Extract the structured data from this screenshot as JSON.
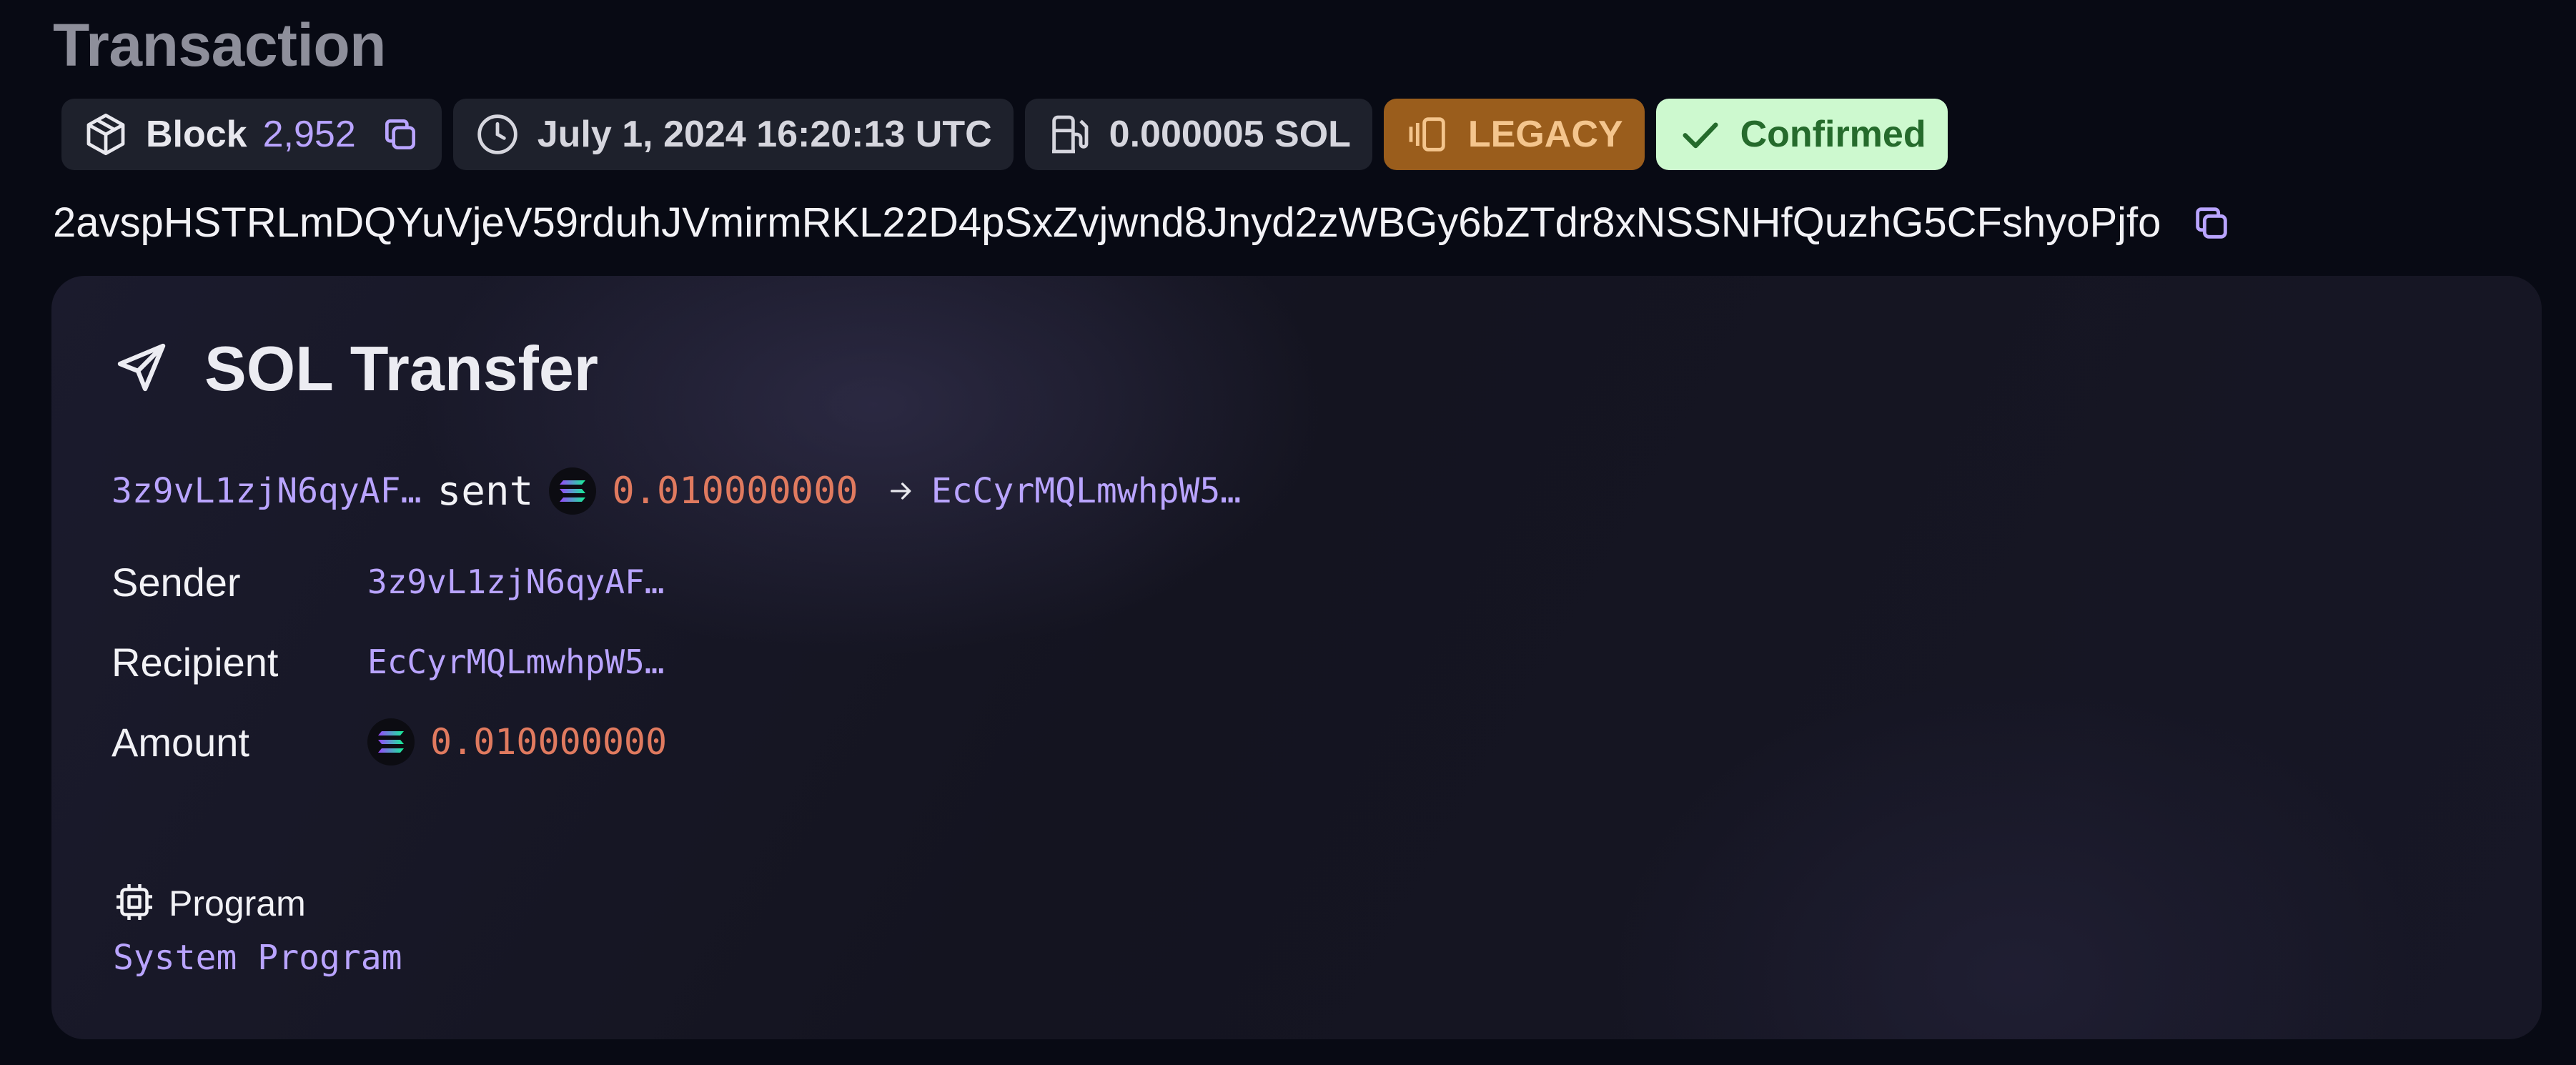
{
  "header": {
    "title": "Transaction"
  },
  "badges": {
    "block_label": "Block",
    "block_number": "2,952",
    "timestamp": "July 1, 2024 16:20:13 UTC",
    "fee": "0.000005 SOL",
    "version": "LEGACY",
    "status": "Confirmed"
  },
  "signature": "2avspHSTRLmDQYuVjeV59rduhJVmirmRKL22D4pSxZvjwnd8Jnyd2zWBGy6bZTdr8xNSSNHfQuzhG5CFshyoPjfo",
  "transfer": {
    "title": "SOL Transfer",
    "summary": {
      "from": "3z9vL1zjN6qyAF…",
      "verb": "sent",
      "amount": "0.010000000",
      "to": "EcCyrMQLmwhpW5…"
    },
    "rows": {
      "sender_label": "Sender",
      "sender_value": "3z9vL1zjN6qyAF…",
      "recipient_label": "Recipient",
      "recipient_value": "EcCyrMQLmwhpW5…",
      "amount_label": "Amount",
      "amount_value": "0.010000000"
    },
    "program": {
      "label": "Program",
      "name": "System Program"
    }
  },
  "colors": {
    "accent_purple": "#b9a4ff",
    "amount_orange": "#e07a5f",
    "legacy_bg": "#9a5d1c",
    "confirmed_bg": "#cdf9cf",
    "confirmed_text": "#256b2c"
  },
  "icons": {
    "block": "cube-icon",
    "time": "clock-icon",
    "fee": "fuel-icon",
    "version": "legacy-icon",
    "status": "check-icon",
    "copy": "copy-icon",
    "transfer": "send-icon",
    "token": "solana-logo-icon",
    "arrow": "arrow-right-icon",
    "program": "cpu-icon"
  }
}
